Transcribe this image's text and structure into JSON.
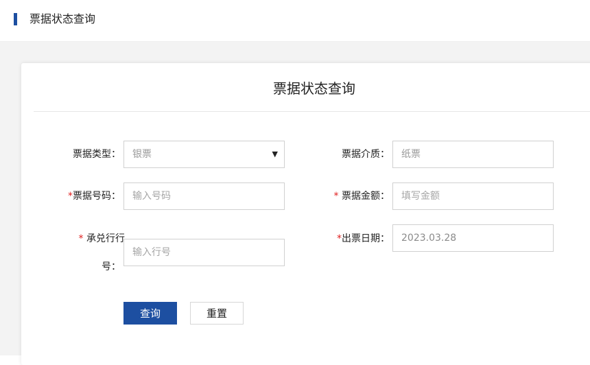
{
  "header": {
    "title": "票据状态查询"
  },
  "card": {
    "title": "票据状态查询"
  },
  "form": {
    "bill_type": {
      "label": "票据类型：",
      "value": "银票"
    },
    "bill_medium": {
      "label": "票据介质：",
      "value": "纸票"
    },
    "bill_number": {
      "required_mark": "*",
      "label": "票据号码：",
      "placeholder": "输入号码"
    },
    "bill_amount": {
      "required_mark": "*",
      "label": "票据金额：",
      "placeholder": "填写金额"
    },
    "acceptor_bank": {
      "required_mark": "*",
      "label_line1": "承兑行行",
      "label_line2": "号：",
      "placeholder": "输入行号"
    },
    "issue_date": {
      "required_mark": "*",
      "label": "出票日期：",
      "value": "2023.03.28"
    }
  },
  "buttons": {
    "query": "查询",
    "reset": "重置"
  },
  "colors": {
    "accent": "#1d4fa1",
    "required": "#e02020",
    "border": "#d0d0d0"
  },
  "icons": {
    "select_caret": "caret-down-icon"
  }
}
